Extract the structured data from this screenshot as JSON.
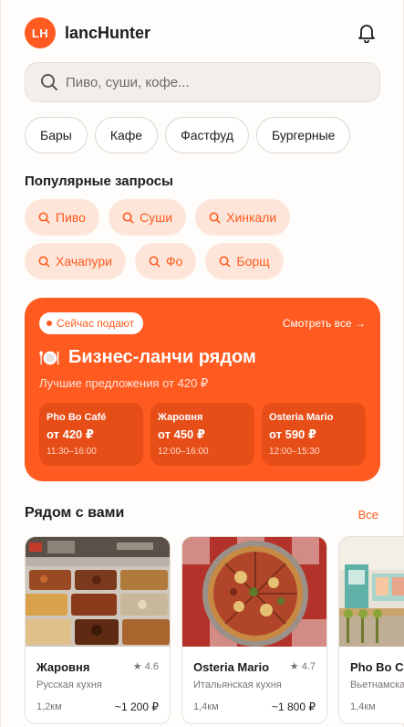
{
  "header": {
    "logo_text": "LH",
    "app_title": "lancHunter",
    "bell_icon": "bell-icon"
  },
  "search": {
    "placeholder": "Пиво, суши, кофе...",
    "icon": "search-icon"
  },
  "categories": [
    "Бары",
    "Кафе",
    "Фастфуд",
    "Бургерные"
  ],
  "popular": {
    "label": "Популярные запросы",
    "items": [
      "Пиво",
      "Суши",
      "Хинкали",
      "Хачапури",
      "Фо",
      "Борщ"
    ]
  },
  "promo": {
    "badge": "Сейчас подают",
    "see_all": "Смотреть все →",
    "title": "Бизнес-ланчи рядом",
    "subtitle": "Лучшие предложения от 420 ₽",
    "offers": [
      {
        "name": "Pho Bo Café",
        "price": "от 420 ₽",
        "time": "11:30–16:00"
      },
      {
        "name": "Жаровня",
        "price": "от 450 ₽",
        "time": "12:00–16:00"
      },
      {
        "name": "Osteria Mario",
        "price": "от 590 ₽",
        "time": "12:00–15:30"
      }
    ]
  },
  "nearby": {
    "title": "Рядом с вами",
    "all_link": "Все",
    "cards": [
      {
        "name": "Жаровня",
        "rating": "4.6",
        "cuisine": "Русская кухня",
        "distance": "1,2км",
        "price": "~1 200 ₽"
      },
      {
        "name": "Osteria Mario",
        "rating": "4.7",
        "cuisine": "Итальянская кухня",
        "distance": "1,4км",
        "price": "~1 800 ₽"
      },
      {
        "name": "Pho Bo Café",
        "rating": "",
        "cuisine": "Вьетнамская кухня",
        "distance": "1,4км",
        "price": ""
      }
    ]
  },
  "colors": {
    "accent": "#ff5a1f",
    "tag_bg": "#fde6d9",
    "offer_bg": "#e64d17"
  }
}
